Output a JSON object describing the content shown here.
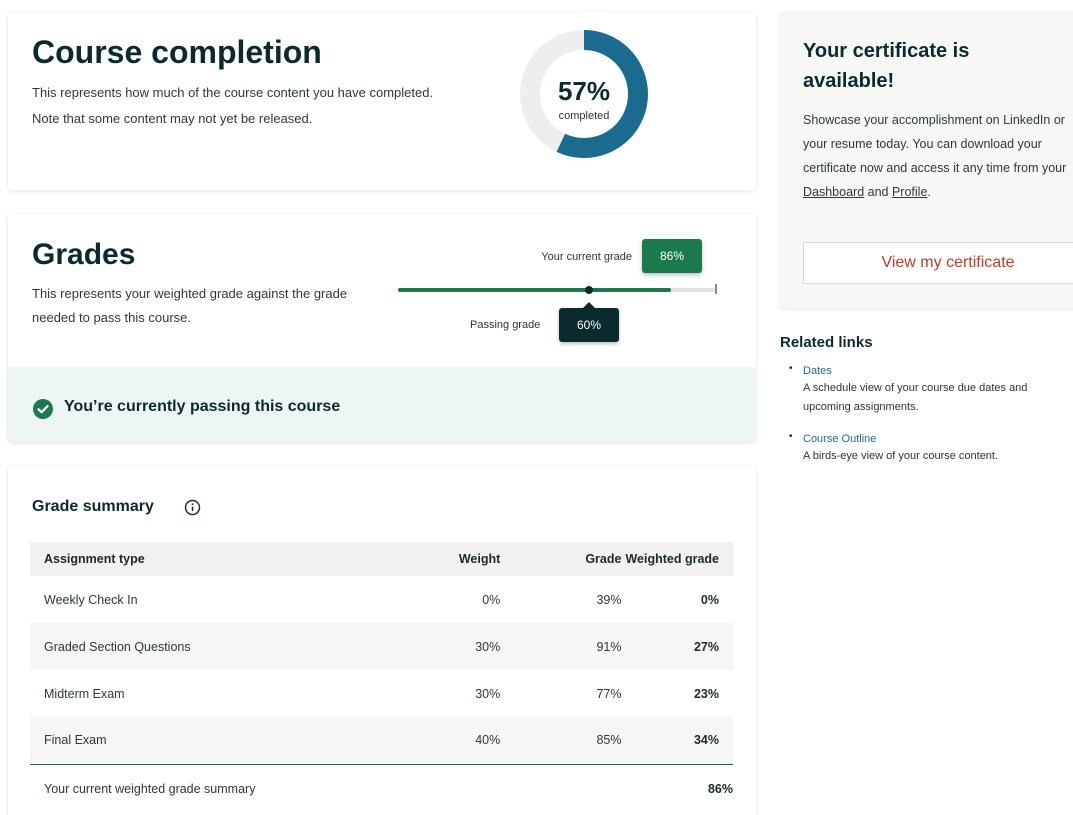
{
  "completion": {
    "title": "Course completion",
    "description": "This represents how much of the course content you have completed. Note that some content may not yet be released.",
    "percent_text": "57%",
    "percent_value": 57,
    "completed_label": "completed",
    "colors": {
      "complete": "#1a6b8f",
      "incomplete": "#eeeeee"
    }
  },
  "grades": {
    "title": "Grades",
    "description": "This represents your weighted grade against the grade needed to pass this course.",
    "current_label": "Your current grade",
    "current_value": "86%",
    "current_fraction": 0.86,
    "passing_label": "Passing grade",
    "passing_value": "60%",
    "passing_fraction": 0.6,
    "status_text": "You’re currently passing this course",
    "colors": {
      "current": "#1b7a4c",
      "passing": "#0b2a2e"
    }
  },
  "summary": {
    "title": "Grade summary",
    "columns": [
      "Assignment type",
      "Weight",
      "Grade",
      "Weighted grade"
    ],
    "rows": [
      {
        "type": "Weekly Check In",
        "weight": "0%",
        "grade": "39%",
        "weighted": "0%"
      },
      {
        "type": "Graded Section Questions",
        "weight": "30%",
        "grade": "91%",
        "weighted": "27%"
      },
      {
        "type": "Midterm Exam",
        "weight": "30%",
        "grade": "77%",
        "weighted": "23%"
      },
      {
        "type": "Final Exam",
        "weight": "40%",
        "grade": "85%",
        "weighted": "34%"
      }
    ],
    "total_label": "Your current weighted grade summary",
    "total_value": "86%"
  },
  "certificate": {
    "title": "Your certificate is available!",
    "desc_before": "Showcase your accomplishment on LinkedIn or your resume today. You can download your certificate now and access it any time from your ",
    "dashboard_link": "Dashboard",
    "desc_and": " and ",
    "profile_link": "Profile",
    "desc_end": ".",
    "button_label": "View my certificate"
  },
  "related": {
    "title": "Related links",
    "items": [
      {
        "link": "Dates",
        "description": "A schedule view of your course due dates and upcoming assignments."
      },
      {
        "link": "Course Outline",
        "description": "A birds-eye view of your course content."
      }
    ]
  }
}
